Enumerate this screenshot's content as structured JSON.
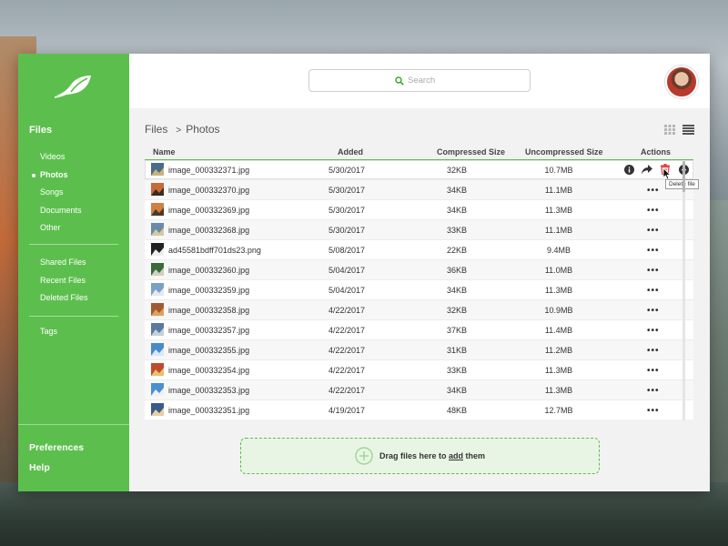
{
  "sidebar": {
    "section_title": "Files",
    "items": [
      {
        "label": "Videos",
        "active": false
      },
      {
        "label": "Photos",
        "active": true
      },
      {
        "label": "Songs",
        "active": false
      },
      {
        "label": "Documents",
        "active": false
      },
      {
        "label": "Other",
        "active": false
      }
    ],
    "items2": [
      {
        "label": "Shared Files"
      },
      {
        "label": "Recent Files"
      },
      {
        "label": "Deleted Files"
      }
    ],
    "tags_label": "Tags",
    "preferences_label": "Preferences",
    "help_label": "Help",
    "accent": "#5cbf4d"
  },
  "search": {
    "placeholder": "Search"
  },
  "breadcrumb": {
    "root": "Files",
    "separator": ">",
    "current": "Photos"
  },
  "table": {
    "headers": {
      "name": "Name",
      "added": "Added",
      "compressed": "Compressed Size",
      "uncompressed": "Uncompressed Size",
      "actions": "Actions"
    },
    "rows": [
      {
        "name": "image_000332371.jpg",
        "added": "5/30/2017",
        "compressed": "32KB",
        "uncompressed": "10.7MB"
      },
      {
        "name": "image_000332370.jpg",
        "added": "5/30/2017",
        "compressed": "34KB",
        "uncompressed": "11.1MB"
      },
      {
        "name": "image_000332369.jpg",
        "added": "5/30/2017",
        "compressed": "34KB",
        "uncompressed": "11.3MB"
      },
      {
        "name": "image_000332368.jpg",
        "added": "5/30/2017",
        "compressed": "33KB",
        "uncompressed": "11.1MB"
      },
      {
        "name": "ad45581bdff701ds23.png",
        "added": "5/08/2017",
        "compressed": "22KB",
        "uncompressed": "9.4MB"
      },
      {
        "name": "image_000332360.jpg",
        "added": "5/04/2017",
        "compressed": "36KB",
        "uncompressed": "11.0MB"
      },
      {
        "name": "image_000332359.jpg",
        "added": "5/04/2017",
        "compressed": "34KB",
        "uncompressed": "11.3MB"
      },
      {
        "name": "image_000332358.jpg",
        "added": "4/22/2017",
        "compressed": "32KB",
        "uncompressed": "10.9MB"
      },
      {
        "name": "image_000332357.jpg",
        "added": "4/22/2017",
        "compressed": "37KB",
        "uncompressed": "11.4MB"
      },
      {
        "name": "image_000332355.jpg",
        "added": "4/22/2017",
        "compressed": "31KB",
        "uncompressed": "11.2MB"
      },
      {
        "name": "image_000332354.jpg",
        "added": "4/22/2017",
        "compressed": "33KB",
        "uncompressed": "11.3MB"
      },
      {
        "name": "image_000332353.jpg",
        "added": "4/22/2017",
        "compressed": "34KB",
        "uncompressed": "11.3MB"
      },
      {
        "name": "image_000332351.jpg",
        "added": "4/19/2017",
        "compressed": "48KB",
        "uncompressed": "12.7MB"
      }
    ],
    "more_label": "•••",
    "tooltip": "Delete file",
    "icons": [
      "info-icon",
      "share-icon",
      "trash-icon",
      "download-icon"
    ]
  },
  "dropzone": {
    "prefix": "Drag files here to",
    "link": "add",
    "suffix": "them"
  }
}
